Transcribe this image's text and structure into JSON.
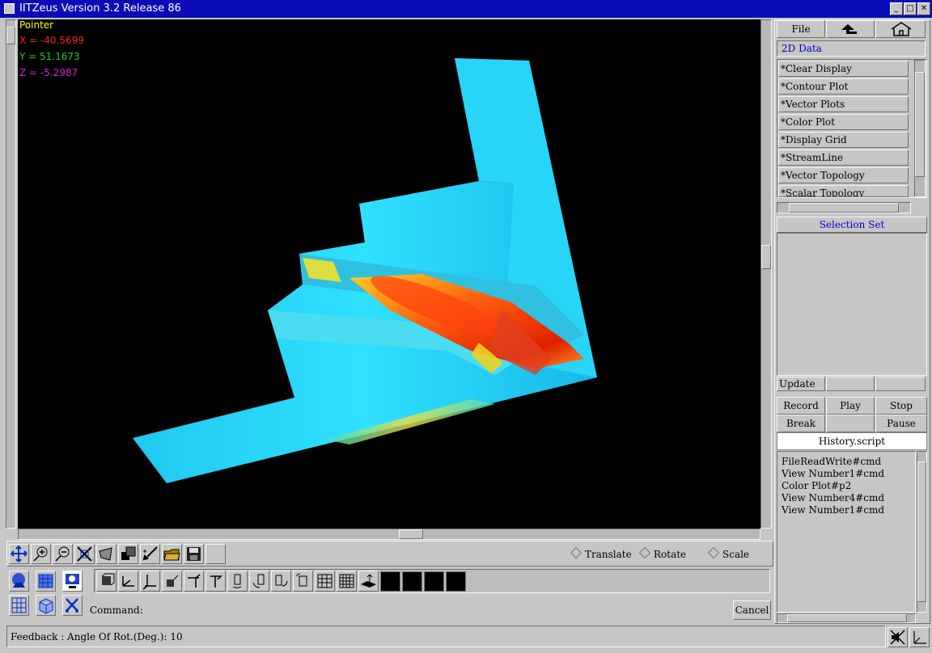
{
  "window": {
    "title": "IITZeus Version 3.2 Release 86"
  },
  "viewport": {
    "pointer_label": "Pointer",
    "x_label": "X = -40.5699",
    "y_label": "Y = 51.1673",
    "z_label": "Z = -5.2987",
    "colors": {
      "pointer": "#ffff00",
      "x": "#ff2020",
      "y": "#20d020",
      "z": "#d020d0"
    }
  },
  "right_panel": {
    "file_label": "File",
    "section_label": "2D Data",
    "menu_items": [
      "*Clear Display",
      "*Contour Plot",
      "*Vector Plots",
      "*Color Plot",
      "*Display Grid",
      "*StreamLine",
      "*Vector Topology",
      "*Scalar Topology"
    ],
    "selection_set_label": "Selection Set",
    "update_label": "Update",
    "record_label": "Record",
    "play_label": "Play",
    "stop_label": "Stop",
    "break_label": "Break",
    "pause_label": "Pause",
    "history_title": "History.script",
    "history_lines": [
      "FileReadWrite#cmd",
      "View Number1#cmd",
      "Color Plot#p2",
      "View Number4#cmd",
      "View Number1#cmd"
    ]
  },
  "toolbar": {
    "translate_label": "Translate",
    "rotate_label": "Rotate",
    "scale_label": "Scale"
  },
  "command": {
    "label": "Command:",
    "value": "",
    "cancel_label": "Cancel"
  },
  "status": {
    "feedback": "Feedback : Angle Of Rot.(Deg.):  10"
  }
}
